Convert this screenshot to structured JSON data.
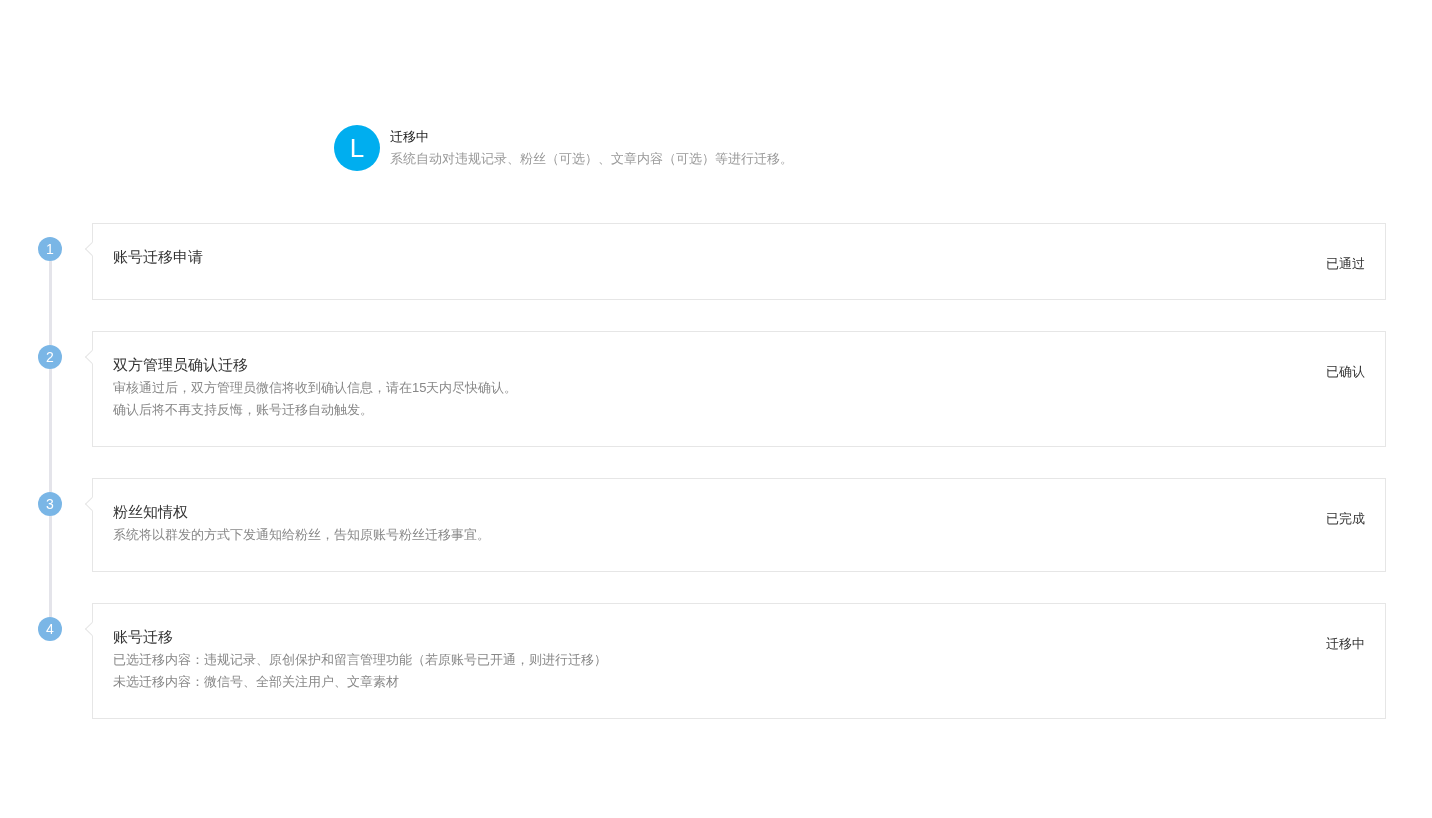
{
  "header": {
    "avatar_letter": "L",
    "title": "迁移中",
    "description": "系统自动对违规记录、粉丝（可选）、文章内容（可选）等进行迁移。"
  },
  "steps": [
    {
      "number": "1",
      "title": "账号迁移申请",
      "status": "已通过"
    },
    {
      "number": "2",
      "title": "双方管理员确认迁移",
      "lines": [
        "审核通过后，双方管理员微信将收到确认信息，请在15天内尽快确认。",
        "确认后将不再支持反悔，账号迁移自动触发。"
      ],
      "status": "已确认"
    },
    {
      "number": "3",
      "title": "粉丝知情权",
      "lines": [
        "系统将以群发的方式下发通知给粉丝，告知原账号粉丝迁移事宜。"
      ],
      "status": "已完成"
    },
    {
      "number": "4",
      "title": "账号迁移",
      "lines": [
        "已选迁移内容：违规记录、原创保护和留言管理功能（若原账号已开通，则进行迁移）",
        "未选迁移内容：微信号、全部关注用户、文章素材"
      ],
      "status": "迁移中"
    }
  ]
}
